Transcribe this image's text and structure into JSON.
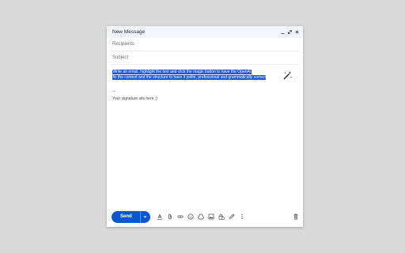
{
  "compose": {
    "title": "New Message",
    "recipients_placeholder": "Recipients",
    "subject_placeholder": "Subject",
    "body_lines": [
      "Write an email, highlight the text and click the magic button to have the OpenAI",
      "fix the content and the structure to have it polite, professional and grammatically correct"
    ],
    "signature_separator": "--",
    "signature": "Your signature sits here ;)",
    "send_label": "Send",
    "icons": {
      "minimize": "minimize-icon",
      "popout": "popout-icon",
      "close": "close-icon",
      "magic": "magic-wand-icon",
      "formatting": "text-format-icon",
      "attach": "attachment-icon",
      "link": "link-icon",
      "emoji": "emoji-icon",
      "drive": "drive-icon",
      "photo": "photo-icon",
      "confidential": "lock-clock-icon",
      "signature": "pen-icon",
      "more": "more-options-icon",
      "delete": "trash-icon"
    },
    "colors": {
      "accent": "#0b57d0",
      "highlight": "#1a56d6",
      "titlebar": "#f2f6fc"
    }
  }
}
